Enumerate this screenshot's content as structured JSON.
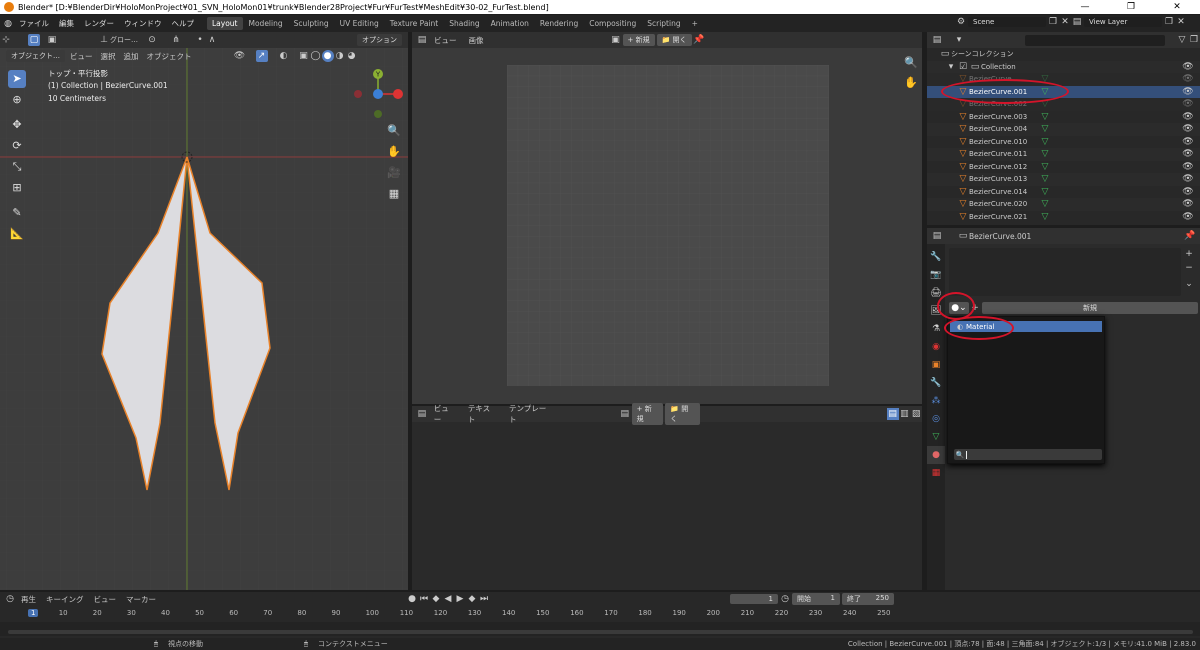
{
  "title": "Blender* [D:¥BlenderDir¥HoloMonProject¥01_SVN_HoloMon01¥trunk¥Blender28Project¥Fur¥FurTest¥MeshEdit¥30-02_FurTest.blend]",
  "window_buttons": [
    "—",
    "❐",
    "✕"
  ],
  "menus": [
    "ファイル",
    "編集",
    "レンダー",
    "ウィンドウ",
    "ヘルプ"
  ],
  "workspaces": [
    "Layout",
    "Modeling",
    "Sculpting",
    "UV Editing",
    "Texture Paint",
    "Shading",
    "Animation",
    "Rendering",
    "Compositing",
    "Scripting"
  ],
  "active_workspace": "Layout",
  "add_workspace": "+",
  "scene": "Scene",
  "view_layer": "View Layer",
  "viewport": {
    "mode": "オブジェクト…",
    "menus": [
      "ビュー",
      "選択",
      "追加",
      "オブジェクト"
    ],
    "transform": "グロー…",
    "options": "オプション",
    "overlay_lines": [
      "トップ・平行投影",
      "(1) Collection | BezierCurve.001",
      "10 Centimeters"
    ],
    "gizmo_y": "Y"
  },
  "image_editor": {
    "menus": [
      "ビュー",
      "画像"
    ],
    "new_btn": "新規",
    "open_btn": "開く"
  },
  "text_editor": {
    "menus": [
      "ビュー",
      "テキスト",
      "テンプレート"
    ],
    "new_btn": "新規",
    "open_btn": "開く"
  },
  "outliner": {
    "search_placeholder": "",
    "root": "シーンコレクション",
    "collection": "Collection",
    "items": [
      "BezierCurve",
      "BezierCurve.001",
      "BezierCurve.002",
      "BezierCurve.003",
      "BezierCurve.004",
      "BezierCurve.010",
      "BezierCurve.011",
      "BezierCurve.012",
      "BezierCurve.013",
      "BezierCurve.014",
      "BezierCurve.020",
      "BezierCurve.021"
    ],
    "selected_index": 1
  },
  "properties": {
    "object_name": "BezierCurve.001",
    "new_btn": "新規",
    "dropdown_item": "Material",
    "search_value": ""
  },
  "timeline": {
    "menus": [
      "再生",
      "キーイング",
      "ビュー",
      "マーカー"
    ],
    "current_frame": "1",
    "start_label": "開始",
    "start": "1",
    "end_label": "終了",
    "end": "250",
    "ticks": [
      "1",
      "10",
      "20",
      "30",
      "40",
      "50",
      "60",
      "70",
      "80",
      "90",
      "100",
      "110",
      "120",
      "130",
      "140",
      "150",
      "160",
      "170",
      "180",
      "190",
      "200",
      "210",
      "220",
      "230",
      "240",
      "250"
    ]
  },
  "status": {
    "left": "視点の移動",
    "middle": "コンテクストメニュー",
    "right": "Collection | BezierCurve.001 | 頂点:78 | 面:48 | 三角面:84 | オブジェクト:1/3 | メモリ:41.0 MiB | 2.83.0"
  },
  "colors": {
    "accent": "#5680c2",
    "selection": "#344f7a",
    "annotation": "#d4142a",
    "object_outline": "#e8822a"
  }
}
